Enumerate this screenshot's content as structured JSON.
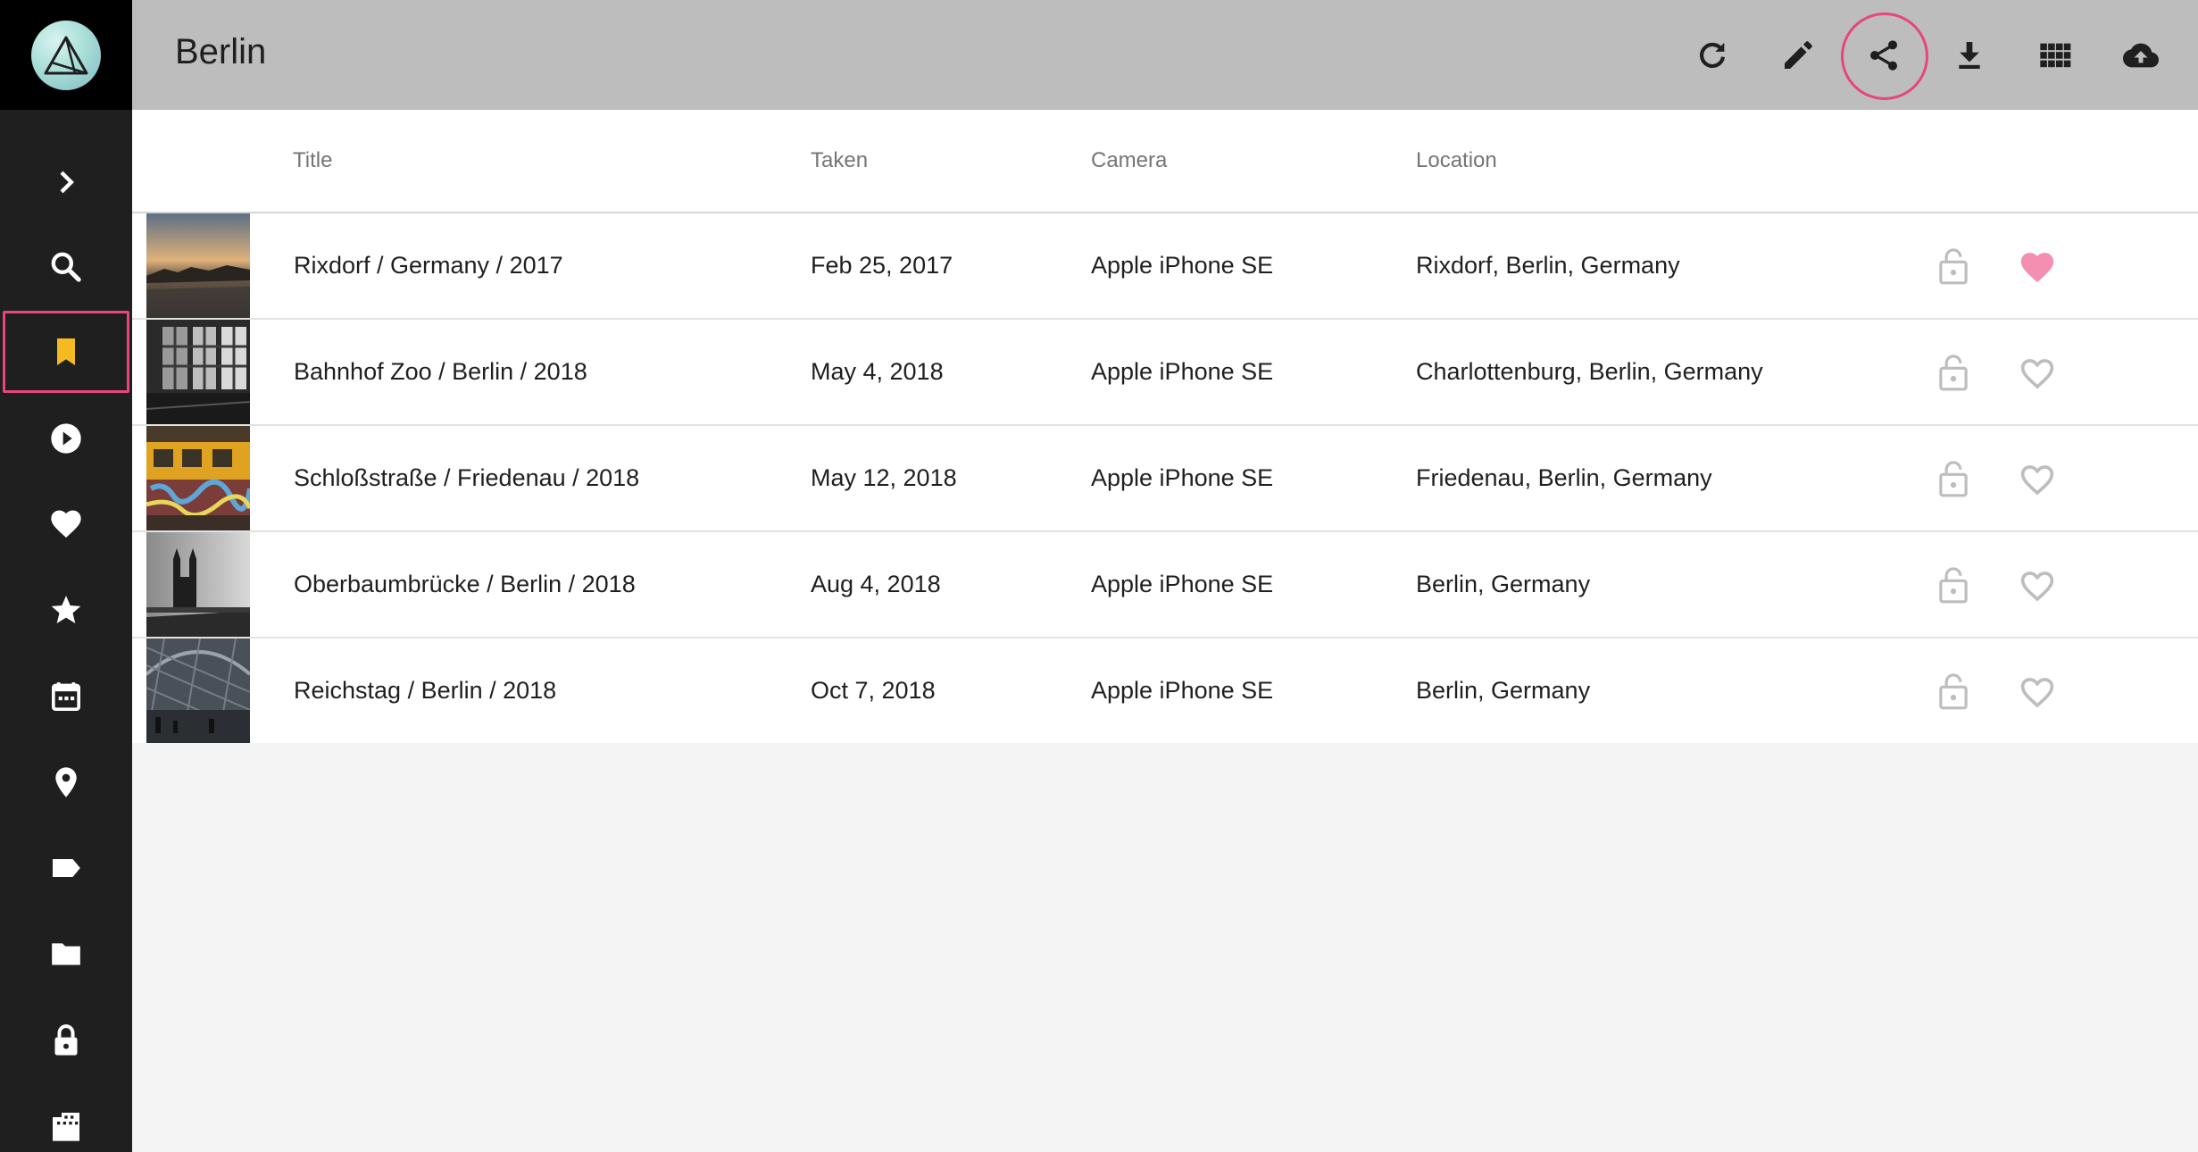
{
  "app": {
    "title": "Berlin"
  },
  "colors": {
    "accent": "#e8457a",
    "bookmark": "#f5b921",
    "favorite": "#f48fb1",
    "toolbar": "#bdbdbd",
    "sidebar": "#1f1f1f"
  },
  "sidebar": {
    "items": [
      {
        "icon": "chevron-right-icon"
      },
      {
        "icon": "search-icon"
      },
      {
        "icon": "bookmark-icon",
        "selected": true
      },
      {
        "icon": "play-circle-icon"
      },
      {
        "icon": "heart-icon"
      },
      {
        "icon": "star-icon"
      },
      {
        "icon": "calendar-icon"
      },
      {
        "icon": "map-pin-icon"
      },
      {
        "icon": "label-icon"
      },
      {
        "icon": "folder-icon"
      },
      {
        "icon": "lock-icon"
      },
      {
        "icon": "film-icon"
      }
    ]
  },
  "toolbar": {
    "actions": [
      {
        "icon": "refresh-icon"
      },
      {
        "icon": "pencil-icon"
      },
      {
        "icon": "share-icon",
        "highlighted": true
      },
      {
        "icon": "download-icon"
      },
      {
        "icon": "grid-view-icon"
      },
      {
        "icon": "cloud-upload-icon"
      }
    ]
  },
  "table": {
    "headers": {
      "title": "Title",
      "taken": "Taken",
      "camera": "Camera",
      "location": "Location"
    },
    "rows": [
      {
        "title": "Rixdorf / Germany / 2017",
        "taken": "Feb 25, 2017",
        "camera": "Apple iPhone SE",
        "location": "Rixdorf, Berlin, Germany",
        "favorite": true
      },
      {
        "title": "Bahnhof Zoo / Berlin / 2018",
        "taken": "May 4, 2018",
        "camera": "Apple iPhone SE",
        "location": "Charlottenburg, Berlin, Germany",
        "favorite": false
      },
      {
        "title": "Schloßstraße / Friedenau / 2018",
        "taken": "May 12, 2018",
        "camera": "Apple iPhone SE",
        "location": "Friedenau, Berlin, Germany",
        "favorite": false
      },
      {
        "title": "Oberbaumbrücke / Berlin / 2018",
        "taken": "Aug 4, 2018",
        "camera": "Apple iPhone SE",
        "location": "Berlin, Germany",
        "favorite": false
      },
      {
        "title": "Reichstag / Berlin / 2018",
        "taken": "Oct 7, 2018",
        "camera": "Apple iPhone SE",
        "location": "Berlin, Germany",
        "favorite": false
      }
    ]
  }
}
